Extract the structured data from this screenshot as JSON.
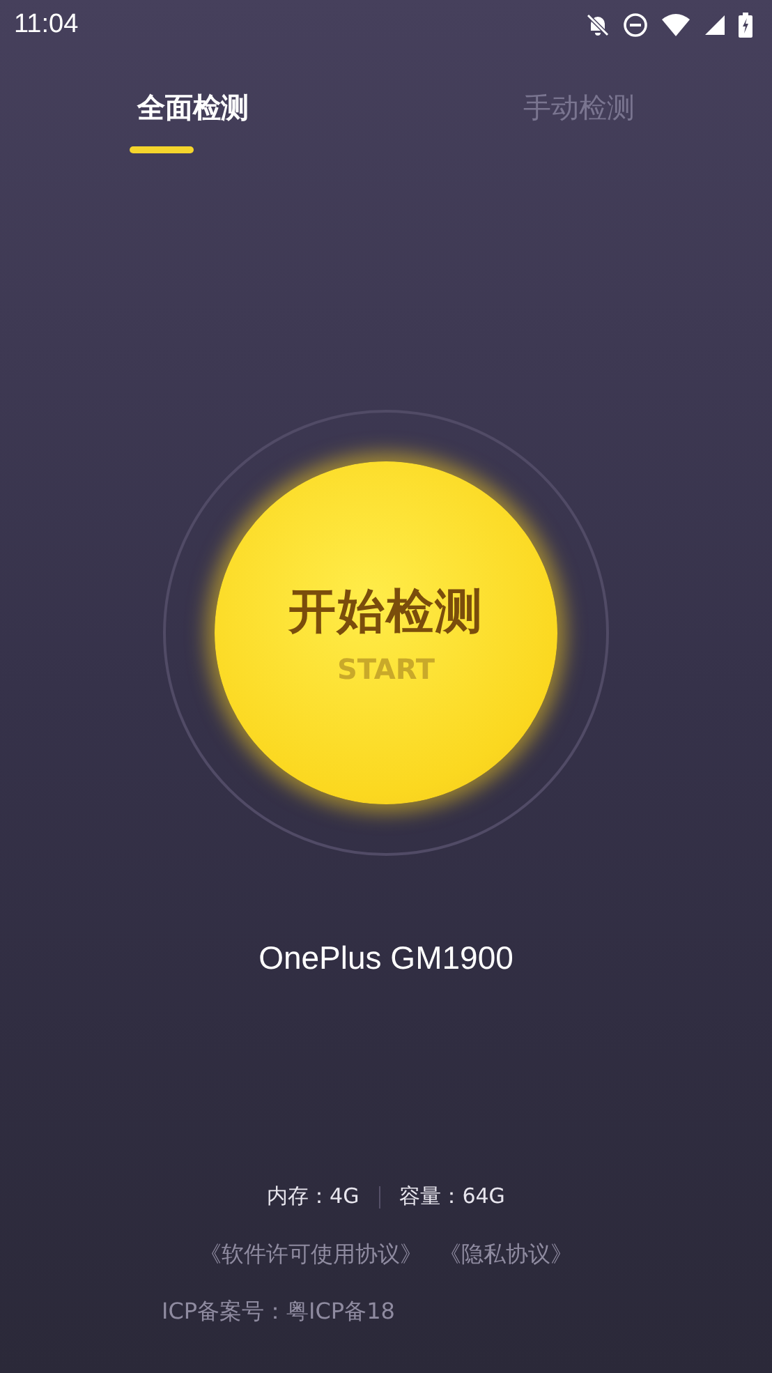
{
  "status_bar": {
    "time": "11:04"
  },
  "tabs": [
    {
      "label": "全面检测",
      "selected": true
    },
    {
      "label": "手动检测",
      "selected": false
    }
  ],
  "start_button": {
    "title": "开始检测",
    "subtitle": "START"
  },
  "device_name": "OnePlus GM1900",
  "specs": [
    {
      "label": "内存：4G"
    },
    {
      "label": "容量：64G"
    }
  ],
  "agreements": [
    "《软件许可使用协议》",
    "《隐私协议》"
  ],
  "icp": "ICP备案号：粤ICP备18"
}
